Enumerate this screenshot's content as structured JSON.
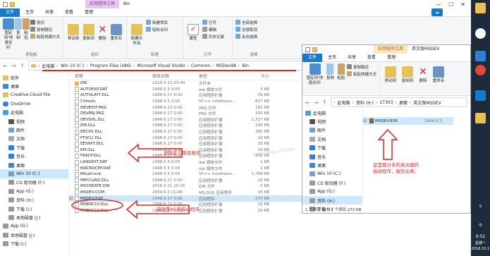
{
  "main": {
    "context_tab": "应用程序工具",
    "window_title": "Bin",
    "ribbon_tabs": [
      "文件",
      "主页",
      "共享",
      "查看",
      "管理"
    ],
    "ribbon": {
      "clipboard": {
        "pin": "固定到'快速访问'",
        "copy": "复制",
        "paste": "粘贴",
        "cut": "剪切",
        "copy_path": "复制路径",
        "paste_shortcut": "粘贴快捷方式",
        "group": "剪贴板"
      },
      "organize": {
        "move_to": "移动到",
        "copy_to": "复制到",
        "delete": "删除",
        "rename": "重命名",
        "group": "组织"
      },
      "new": {
        "new_item": "新建项目",
        "easy_access": "轻松访问",
        "new_folder": "新建文件夹",
        "group": "新建"
      },
      "open": {
        "properties": "属性",
        "open": "打开",
        "edit": "编辑",
        "history": "历史记录",
        "group": "打开"
      },
      "select": {
        "select_all": "全部选择",
        "select_none": "全部取消",
        "invert": "反向选择",
        "group": "选择"
      }
    },
    "breadcrumb": [
      "此电脑",
      "Win 10 (C:)",
      "Program Files (x86)",
      "Microsoft Visual Studio",
      "Common",
      "MSDev98",
      "Bin"
    ],
    "columns": {
      "name": "名称",
      "date": "修改日期",
      "type": "类型",
      "size": "大小"
    },
    "nav": [
      "软件",
      "桌面",
      "Creative Cloud File",
      "OneDrive",
      "此电脑",
      "视频",
      "图片",
      "文档",
      "下载",
      "音乐",
      "桌面",
      "Win 10 (C:)",
      "CD 驱动器 (F:)",
      "App (G:)",
      "资料 (H:)",
      "下载 (I:)",
      "本地磁盘 (J:)",
      "App (G:)",
      "本地磁盘 (J:)",
      "下载 (I:)"
    ],
    "files": [
      {
        "name": "IDE",
        "date": "2016.6.12 23:44",
        "type": "文件夹",
        "size": "",
        "folder": true
      },
      {
        "name": "AUTOEXP.DAT",
        "date": "1998.5.5 0:00",
        "type": "dat 媒体文件",
        "size": "5 KB"
      },
      {
        "name": "AUTOLAYT.DLL",
        "date": "1998.6.17 0:00",
        "type": "应用程序扩展",
        "size": "29 KB"
      },
      {
        "name": "CVtools",
        "date": "1998.5.5 0:00",
        "type": "VC++ Intellisens...",
        "size": "617 KB"
      },
      {
        "name": "DEVEDIT.PKG",
        "date": "1998.6.17 0:00",
        "type": "PKG 文件",
        "size": "181 KB"
      },
      {
        "name": "DEVPRJ.PKG",
        "date": "1998.6.17 0:00",
        "type": "PKG 文件",
        "size": "393 KB"
      },
      {
        "name": "DEVSHL.DLL",
        "date": "1998.6.17 0:00",
        "type": "应用程序扩展",
        "size": "1,317 KB"
      },
      {
        "name": "DM.DLL",
        "date": "1998.6.17 0:00",
        "type": "应用程序扩展",
        "size": "145 KB"
      },
      {
        "name": "EECXX.DLL",
        "date": "1998.6.17 0:00",
        "type": "应用程序扩展",
        "size": "381 KB"
      },
      {
        "name": "FFSCLI.DLL",
        "date": "1998.6.17 0:00",
        "type": "应用程序扩展",
        "size": "29 KB"
      },
      {
        "name": "EESWIT.DLL",
        "date": "1998.6.17 0:00",
        "type": "应用程序扩展",
        "size": "29 KB"
      },
      {
        "name": "EM.DLL",
        "date": "1998.6.17 0:00",
        "type": "应用程序扩展",
        "size": "29 KB"
      },
      {
        "name": "FEACP.DLL",
        "date": "1998.6.17 0:00",
        "type": "应用程序扩展",
        "size": "845 KB"
      },
      {
        "name": "LANGEXT.DAT",
        "date": "1998.5.5 0:00",
        "type": "dat 媒体文件",
        "size": "1 KB"
      },
      {
        "name": "MACROCPP.DAT",
        "date": "1998.5.5 0:00",
        "type": "dat 媒体文件",
        "size": "2 KB"
      },
      {
        "name": "Mfcatl.ncb",
        "date": "1998.5.5 0:00",
        "type": "VC++ Intellisens...",
        "size": "1,769 KB"
      },
      {
        "name": "MPCCLWZ.DLL",
        "date": "1998.6.17 0:00",
        "type": "应用程序扩展",
        "size": "29 KB"
      },
      {
        "name": "MSCREATE.DIR",
        "date": "2016.5.21 20:26",
        "type": "DIR 文件",
        "size": "0 KB"
      },
      {
        "name": "MSDEV.COM",
        "date": "2004.6.3 21:08",
        "type": "MS-DOS 应用程序",
        "size": "33 KB"
      },
      {
        "name": "MSDEV.EXE",
        "date": "1998.6.17 0:00",
        "type": "应用程序",
        "size": "273 KB",
        "selected": true
      },
      {
        "name": "MSENC10.DLL",
        "date": "1998.6.17 0:00",
        "type": "应用程序扩展",
        "size": "29 KB"
      },
      {
        "name": "MSENC10.DLL",
        "date": "1998.6.17 0:00",
        "type": "应用程序扩展",
        "size": "29 KB"
      }
    ],
    "annotation_find": "按照这个路径来找",
    "annotation_startup": "这就是VC的启动程序"
  },
  "second": {
    "context_tab": "应用程序工具",
    "window_title": "英文版MSDEV",
    "ribbon_tabs": [
      "文件",
      "主页",
      "共享",
      "查看",
      "管理"
    ],
    "ribbon": {
      "pin": "固定到'快速访问'",
      "copy": "复制",
      "paste": "粘贴",
      "copy_path": "复制路径",
      "paste_shortcut": "粘贴快捷方式",
      "move_to": "移动到",
      "copy_to": "复制到",
      "delete": "删除",
      "rename": "重命名"
    },
    "breadcrumb": [
      "此电脑",
      "资料 (H:)",
      "17303",
      "桌面",
      "英文版MSDEV"
    ],
    "nav": [
      "此电脑",
      "视频",
      "图片",
      "文档",
      "下载",
      "音乐",
      "桌面",
      "Win 10 (C:)",
      "CD 驱动器 (F:)",
      "App (G:)",
      "资料 (H:)",
      "下载 (I:)"
    ],
    "file": {
      "name": "MSDEV.EXE",
      "date": "2004.6.3"
    },
    "annotation": "这是我分享的英文版的启动程序，解压出来。",
    "status": "1 个项目    选中 1 个项目  272 KB"
  },
  "taskbar": {
    "time": "9:52",
    "day": "星期一",
    "date": "2016.10.1",
    "lang": "中",
    "lang2": "S"
  },
  "watermark": "http://blog.csdn.net/",
  "colors": {
    "accent": "#1979ca",
    "annotation": "#e02424",
    "taskbar": "#1d2b3a",
    "folder": "#e8c05b"
  }
}
